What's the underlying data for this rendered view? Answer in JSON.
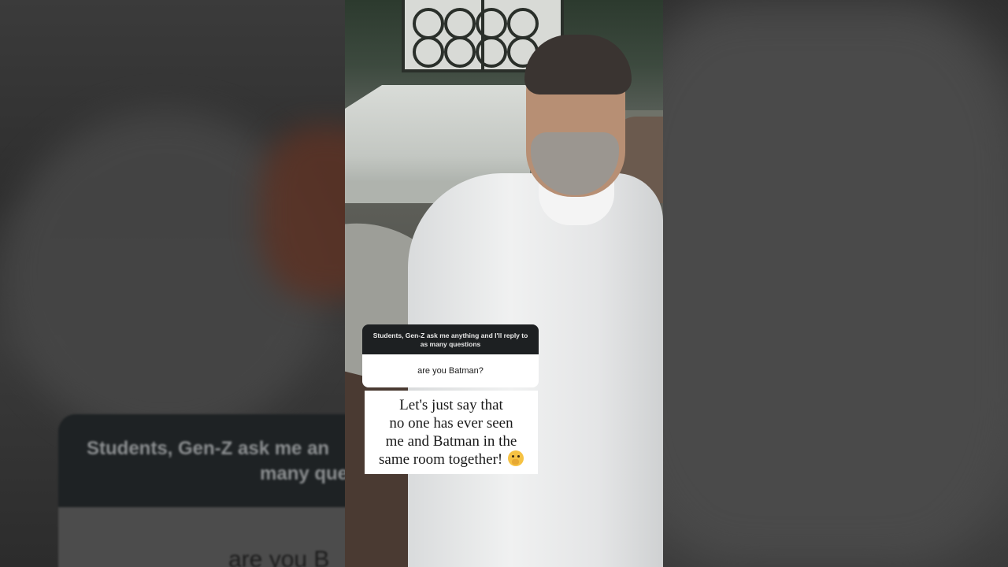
{
  "sticker": {
    "prompt": "Students, Gen-Z ask me anything and I'll reply to as many questions",
    "question": "are you Batman?"
  },
  "reply": {
    "lines": [
      "Let's just say that",
      "no one has ever seen",
      "me and Batman in the",
      "same room together!"
    ],
    "emoji": "shushing-face-emoji"
  },
  "background_blur": {
    "prompt_line1": "Students, Gen-Z ask me an",
    "prompt_line2": "many que",
    "question": "are you B"
  }
}
